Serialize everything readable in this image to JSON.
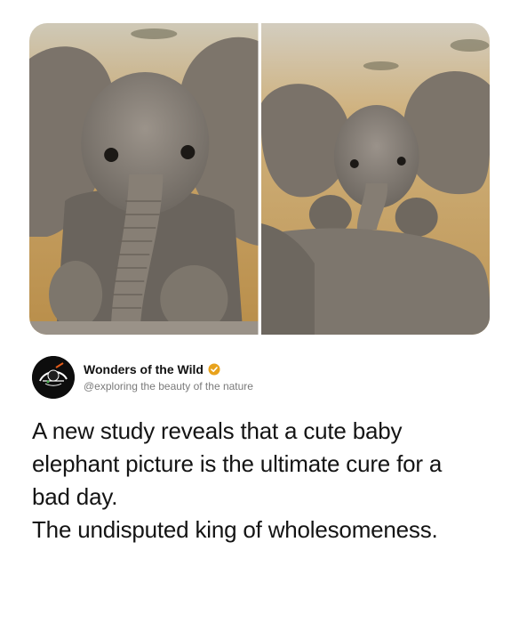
{
  "images": [
    {
      "alt": "baby elephant photo",
      "icon": "elephant-photo-left"
    },
    {
      "alt": "baby elephant photo",
      "icon": "elephant-photo-right"
    }
  ],
  "author": {
    "name": "Wonders of the Wild",
    "handle": "@exploring the beauty of the nature",
    "verified_color": "#E8A21C",
    "avatar_icon": "world-logo-icon"
  },
  "post": {
    "line1": "A new study reveals that a cute baby elephant picture is the ultimate cure for a bad day.",
    "line2": "The undisputed king of wholesomeness."
  },
  "colors": {
    "background": "#FFFFFF",
    "text": "#141414",
    "handle": "#7A7A7A"
  }
}
